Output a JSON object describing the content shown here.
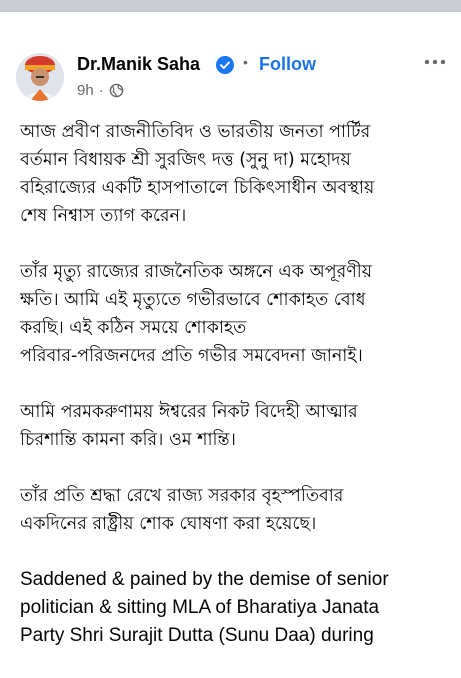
{
  "post": {
    "author": "Dr.Manik Saha",
    "separator": "•",
    "follow_label": "Follow",
    "time": "9h",
    "meta_separator": "·",
    "privacy": "public",
    "paragraphs": [
      "আজ প্রবীণ রাজনীতিবিদ ও ভারতীয় জনতা পার্টির\nবর্তমান বিধায়ক শ্রী সুরজিৎ দত্ত (সুনু দা) মহোদয়\nবহিরাজ্যের একটি হাসপাতালে চিকিৎসাধীন অবস্থায়\nশেষ নিশ্বাস ত্যাগ করেন।",
      "তাঁর মৃত্যু রাজ্যের রাজনৈতিক অঙ্গনে এক অপূরণীয়\nক্ষতি। আমি এই মৃত্যুতে গভীরভাবে শোকাহত বোধ\nকরছি। এই কঠিন সময়ে শোকাহত\nপরিবার-পরিজনদের প্রতি গভীর সমবেদনা জানাই।",
      "আমি পরমকরুণাময় ঈশ্বরের নিকট বিদেহী আত্মার\nচিরশান্তি কামনা করি। ওম শান্তি।",
      "তাঁর প্রতি শ্রদ্ধা রেখে রাজ্য সরকার বৃহস্পতিবার\nএকদিনের রাষ্ট্রীয় শোক ঘোষণা করা হয়েছে।",
      "Saddened & pained by the demise of senior\npolitician & sitting MLA of Bharatiya Janata\nParty Shri Surajit Dutta (Sunu Daa) during"
    ]
  },
  "colors": {
    "accent": "#1b74e4",
    "secondary_text": "#65676b",
    "verified": "#1877f2"
  },
  "icons": {
    "verified": "verified-badge-icon",
    "more": "more-options-icon",
    "privacy": "globe-icon"
  }
}
